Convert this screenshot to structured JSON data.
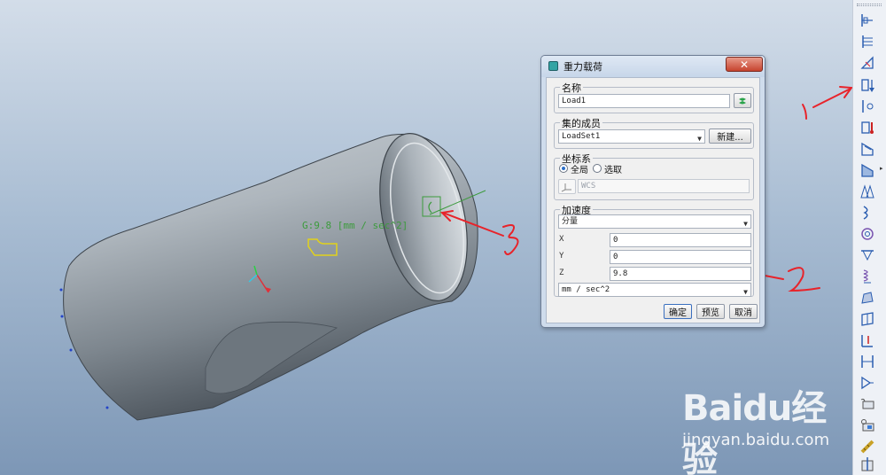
{
  "annotation": {
    "gravity_label": "G:9.8 [mm / sec^2]"
  },
  "handwritten_marks": [
    "1",
    "2",
    "3"
  ],
  "dialog": {
    "title": "重力载荷",
    "close_glyph": "✕",
    "name_section": {
      "label": "名称",
      "value": "Load1"
    },
    "member_section": {
      "label": "集的成员",
      "value": "LoadSet1",
      "new_button": "新建..."
    },
    "coord_section": {
      "label": "坐标系",
      "global_label": "全局",
      "select_label": "选取",
      "selected": "global",
      "csys_value": "WCS"
    },
    "accel_section": {
      "label": "加速度",
      "mode": "分量",
      "x_label": "X",
      "x_value": "0",
      "y_label": "Y",
      "y_value": "0",
      "z_label": "Z",
      "z_value": "9.8",
      "units": "mm / sec^2"
    },
    "buttons": {
      "ok": "确定",
      "preview": "预览",
      "cancel": "取消"
    }
  },
  "toolbar": {
    "icons": [
      "displacement-icon",
      "force-moment-icon",
      "pressure-icon",
      "gravity-load-icon",
      "centrifugal-load-icon",
      "temperature-load-icon",
      "surface-load-icon",
      "shell-icon",
      "shell-pair-icon",
      "beam-icon",
      "spring-icon",
      "mass-icon",
      "weld-icon",
      "rigid-link-icon",
      "contact-icon",
      "interface-icon",
      "bolt-icon",
      "fastener-icon",
      "cut-icon",
      "measure-icon",
      "material-icon"
    ]
  },
  "watermark": {
    "logo": "Baidu经验",
    "url": "jingyan.baidu.com"
  },
  "colors": {
    "accent_red": "#e8232a",
    "annotation_green": "#3c9b3c",
    "annotation_yellow": "#e2d21a"
  }
}
